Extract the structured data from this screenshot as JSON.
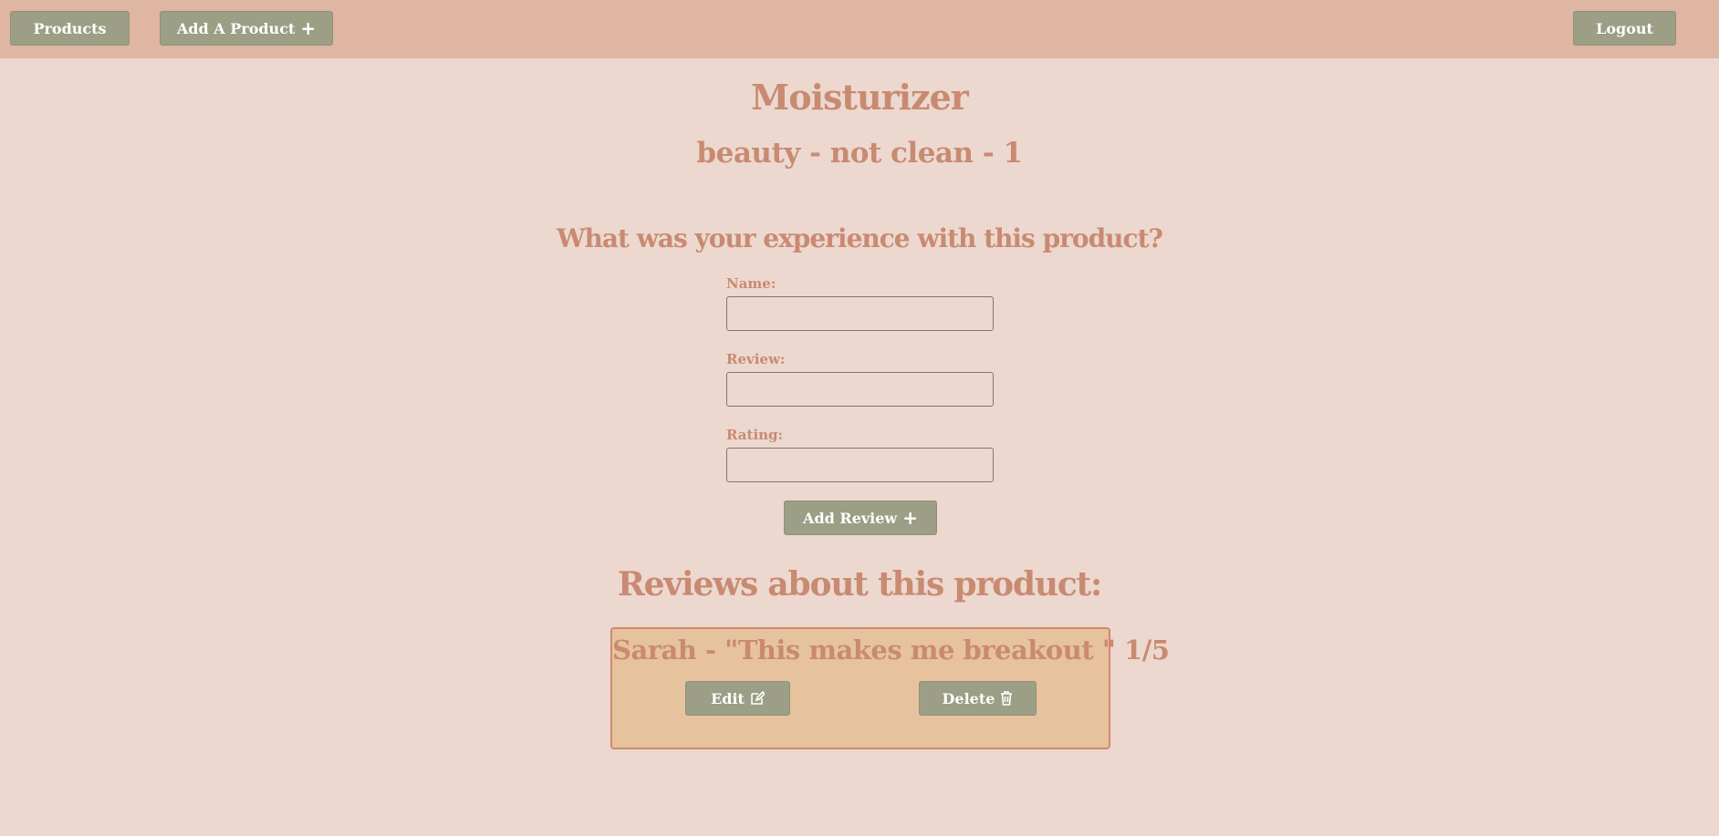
{
  "nav": {
    "products_label": "Products",
    "add_product_label": "Add A Product",
    "logout_label": "Logout"
  },
  "product": {
    "name": "Moisturizer",
    "subtitle": "beauty - not clean - 1"
  },
  "form": {
    "heading": "What was your experience with this product?",
    "name_label": "Name:",
    "name_value": "",
    "review_label": "Review:",
    "review_value": "",
    "rating_label": "Rating:",
    "rating_value": "",
    "submit_label": "Add Review"
  },
  "reviews": {
    "heading": "Reviews about this product:",
    "items": [
      {
        "text": "Sarah - \"This makes me breakout \" 1/5",
        "edit_label": "Edit",
        "delete_label": "Delete"
      }
    ]
  },
  "icons": {
    "plus": "plus-icon",
    "edit": "edit-icon",
    "delete": "trash-icon"
  },
  "colors": {
    "page_bg": "#ecd8ce",
    "navbar_bg": "#dfb6a1",
    "button_bg": "#9c9e85",
    "heading_text": "#c98a72",
    "card_bg": "#e6c39c",
    "card_border": "#d08870"
  }
}
